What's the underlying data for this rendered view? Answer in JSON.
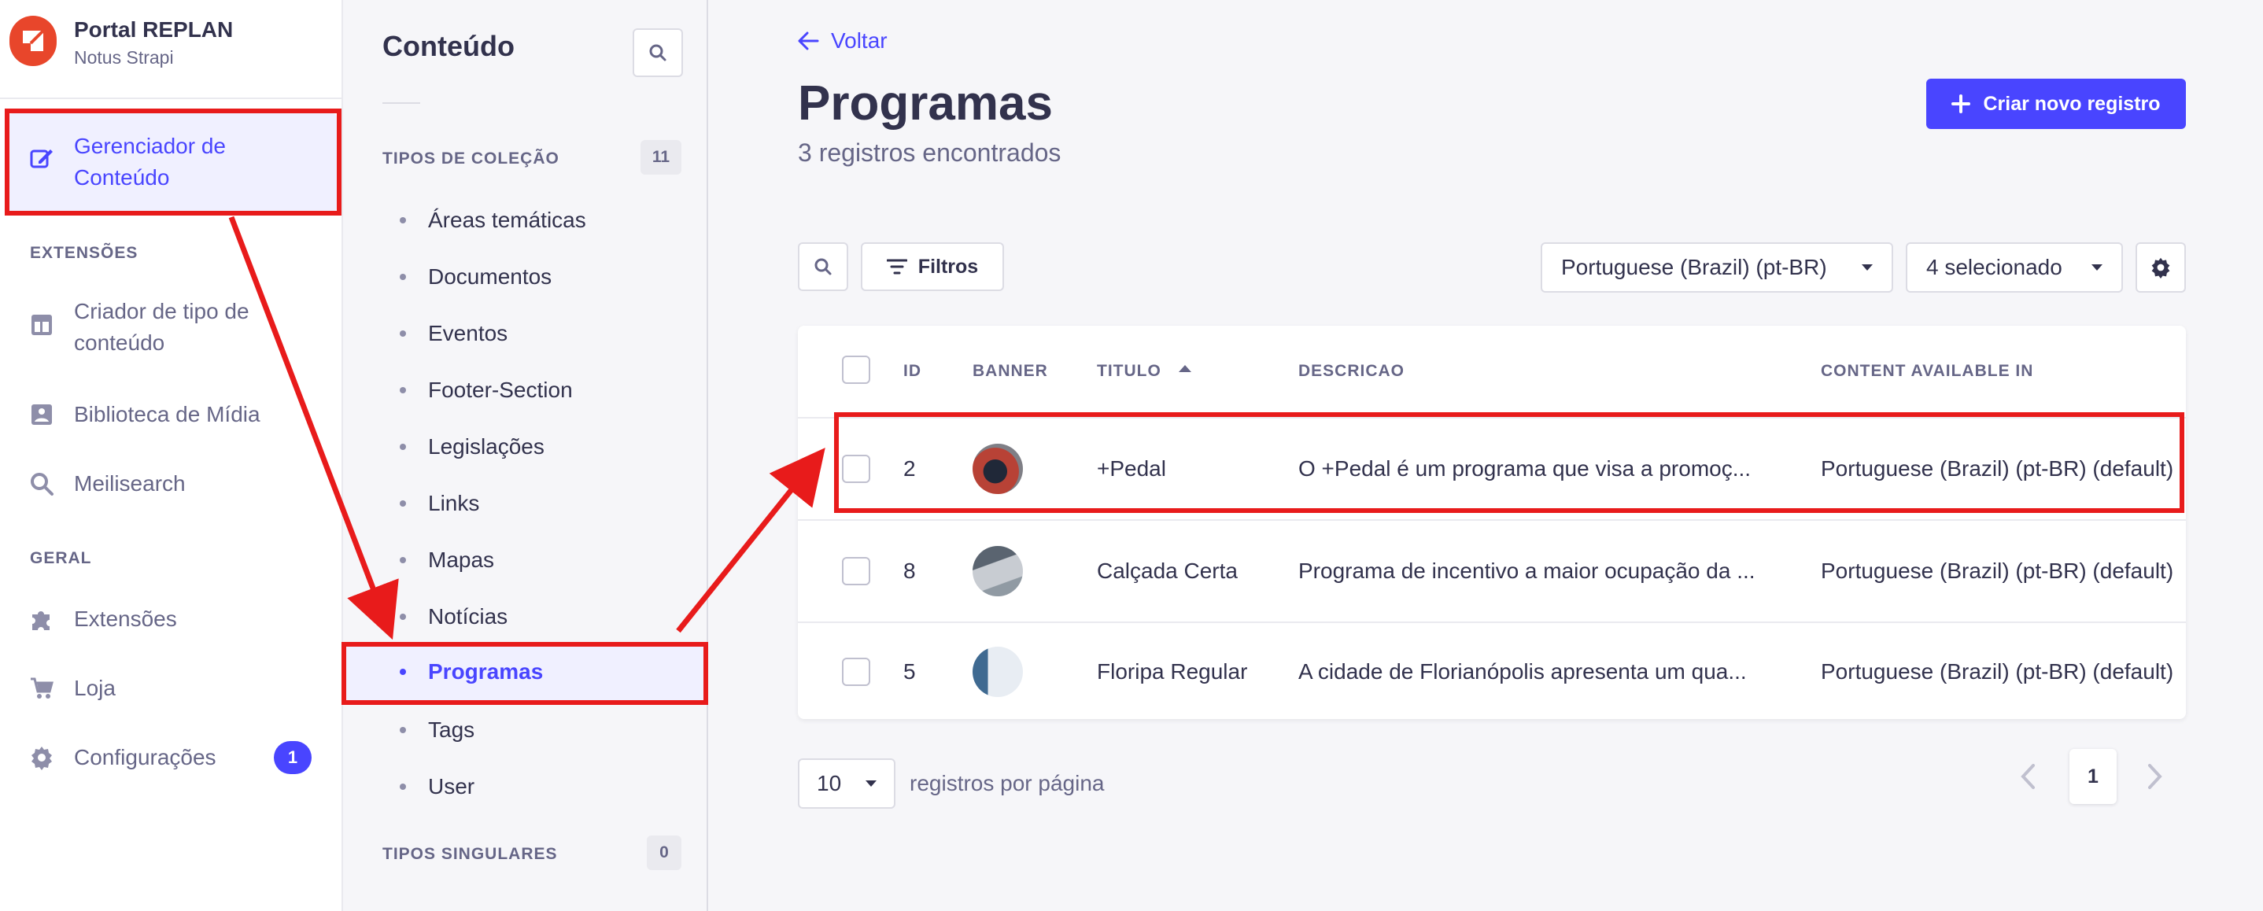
{
  "app": {
    "title": "Portal REPLAN",
    "subtitle": "Notus Strapi"
  },
  "sidebar": {
    "active_item": {
      "label": "Gerenciador de Conteúdo",
      "icon": "feather-edit-icon"
    },
    "sections": [
      {
        "title": "EXTENSÕES"
      },
      {
        "title": "GERAL"
      }
    ],
    "items": [
      {
        "label": "Criador de tipo de conteúdo",
        "icon": "layout-icon"
      },
      {
        "label": "Biblioteca de Mídia",
        "icon": "media-icon"
      },
      {
        "label": "Meilisearch",
        "icon": "search-icon"
      },
      {
        "label": "Extensões",
        "icon": "puzzle-icon"
      },
      {
        "label": "Loja",
        "icon": "cart-icon"
      },
      {
        "label": "Configurações",
        "icon": "gear-icon",
        "badge": "1"
      }
    ]
  },
  "subnav": {
    "title": "Conteúdo",
    "collection_types": {
      "title": "TIPOS DE COLEÇÃO",
      "count": "11"
    },
    "items": [
      "Áreas temáticas",
      "Documentos",
      "Eventos",
      "Footer-Section",
      "Legislações",
      "Links",
      "Mapas",
      "Notícias",
      "Programas",
      "Tags",
      "User"
    ],
    "active_index": 8,
    "single_types": {
      "title": "TIPOS SINGULARES",
      "count": "0"
    }
  },
  "main": {
    "back_label": "Voltar",
    "title": "Programas",
    "subtitle": "3 registros encontrados",
    "create_label": "Criar novo registro",
    "filters_label": "Filtros",
    "locale": "Portuguese (Brazil) (pt-BR)",
    "columns_selected": "4 selecionado",
    "table": {
      "headers": [
        "ID",
        "BANNER",
        "TITULO",
        "DESCRICAO",
        "CONTENT AVAILABLE IN"
      ],
      "rows": [
        {
          "id": "2",
          "titulo": "+Pedal",
          "descricao": "O +Pedal é um programa que visa a promoç...",
          "content": "Portuguese (Brazil) (pt-BR) (default)"
        },
        {
          "id": "8",
          "titulo": "Calçada Certa",
          "descricao": "Programa de incentivo a maior ocupação da ...",
          "content": "Portuguese (Brazil) (pt-BR) (default)"
        },
        {
          "id": "5",
          "titulo": "Floripa Regular",
          "descricao": "A cidade de Florianópolis apresenta um qua...",
          "content": "Portuguese (Brazil) (pt-BR) (default)"
        }
      ]
    },
    "per_page": "10",
    "per_page_label": "registros por página",
    "current_page": "1"
  },
  "colors": {
    "accent": "#4945ff",
    "annotation": "#e81b1b",
    "brand": "#e8462b"
  }
}
